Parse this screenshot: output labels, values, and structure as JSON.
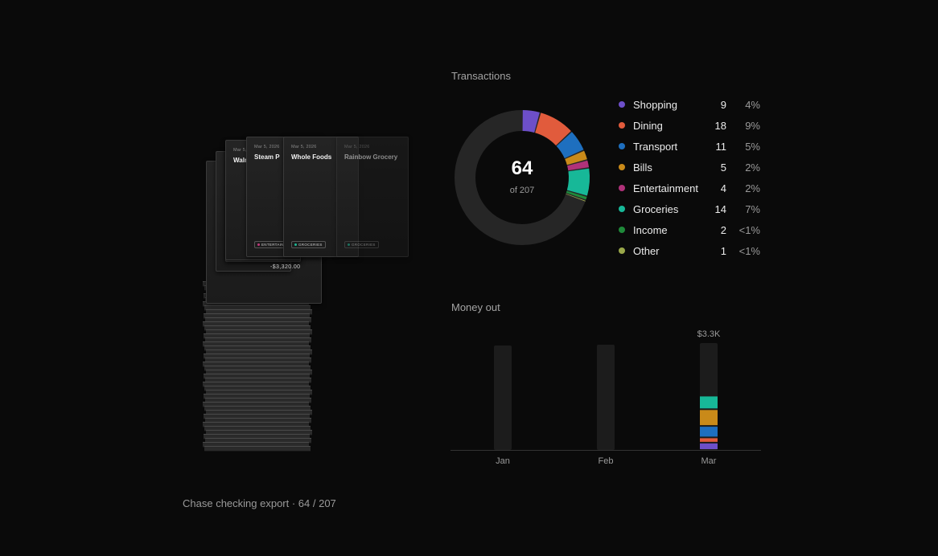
{
  "stack": {
    "cards": [
      {
        "date": "Mar 5, 2026",
        "merchant": "Walmart",
        "tag": "",
        "tag_color": "#888888"
      },
      {
        "date": "Mar 5, 2026",
        "merchant": "Steam P",
        "tag": "ENTERTAINMENT",
        "tag_color": "#c0397a"
      },
      {
        "date": "Mar 5, 2026",
        "merchant": "Whole Foods",
        "tag": "GROCERIES",
        "tag_color": "#1db896"
      },
      {
        "date": "Mar 5, 2026",
        "merchant": "Rainbow Grocery",
        "tag": "GROCERIES",
        "tag_color": "#1db896"
      }
    ],
    "total": "-$3,320.00"
  },
  "footer": {
    "caption": "Chase checking export · 64 / 207"
  },
  "transactions": {
    "title": "Transactions",
    "center_value": "64",
    "center_sub": "of 207",
    "track_color": "#262626",
    "categories": [
      {
        "name": "Shopping",
        "count": "9",
        "pct": "4%",
        "color": "#6d4fc9"
      },
      {
        "name": "Dining",
        "count": "18",
        "pct": "9%",
        "color": "#e15b3c"
      },
      {
        "name": "Transport",
        "count": "11",
        "pct": "5%",
        "color": "#1e6fbf"
      },
      {
        "name": "Bills",
        "count": "5",
        "pct": "2%",
        "color": "#c98a19"
      },
      {
        "name": "Entertainment",
        "count": "4",
        "pct": "2%",
        "color": "#b0327a"
      },
      {
        "name": "Groceries",
        "count": "14",
        "pct": "7%",
        "color": "#17b898"
      },
      {
        "name": "Income",
        "count": "2",
        "pct": "<1%",
        "color": "#1f8a3a"
      },
      {
        "name": "Other",
        "count": "1",
        "pct": "<1%",
        "color": "#9aa84a"
      }
    ]
  },
  "money_out": {
    "title": "Money out",
    "chart_data": {
      "type": "bar",
      "categories": [
        "Jan",
        "Feb",
        "Mar"
      ],
      "max_label": "$3.3K",
      "stacks": [
        {
          "month": "Jan",
          "segments": []
        },
        {
          "month": "Feb",
          "segments": []
        },
        {
          "month": "Mar",
          "segments": [
            {
              "category": "Shopping",
              "fraction": 0.07,
              "color": "#6d4fc9"
            },
            {
              "category": "Dining",
              "fraction": 0.05,
              "color": "#e15b3c"
            },
            {
              "category": "Transport",
              "fraction": 0.11,
              "color": "#1e6fbf"
            },
            {
              "category": "Bills",
              "fraction": 0.16,
              "color": "#c98a19"
            },
            {
              "category": "Groceries",
              "fraction": 0.13,
              "color": "#17b898"
            }
          ]
        }
      ]
    }
  }
}
